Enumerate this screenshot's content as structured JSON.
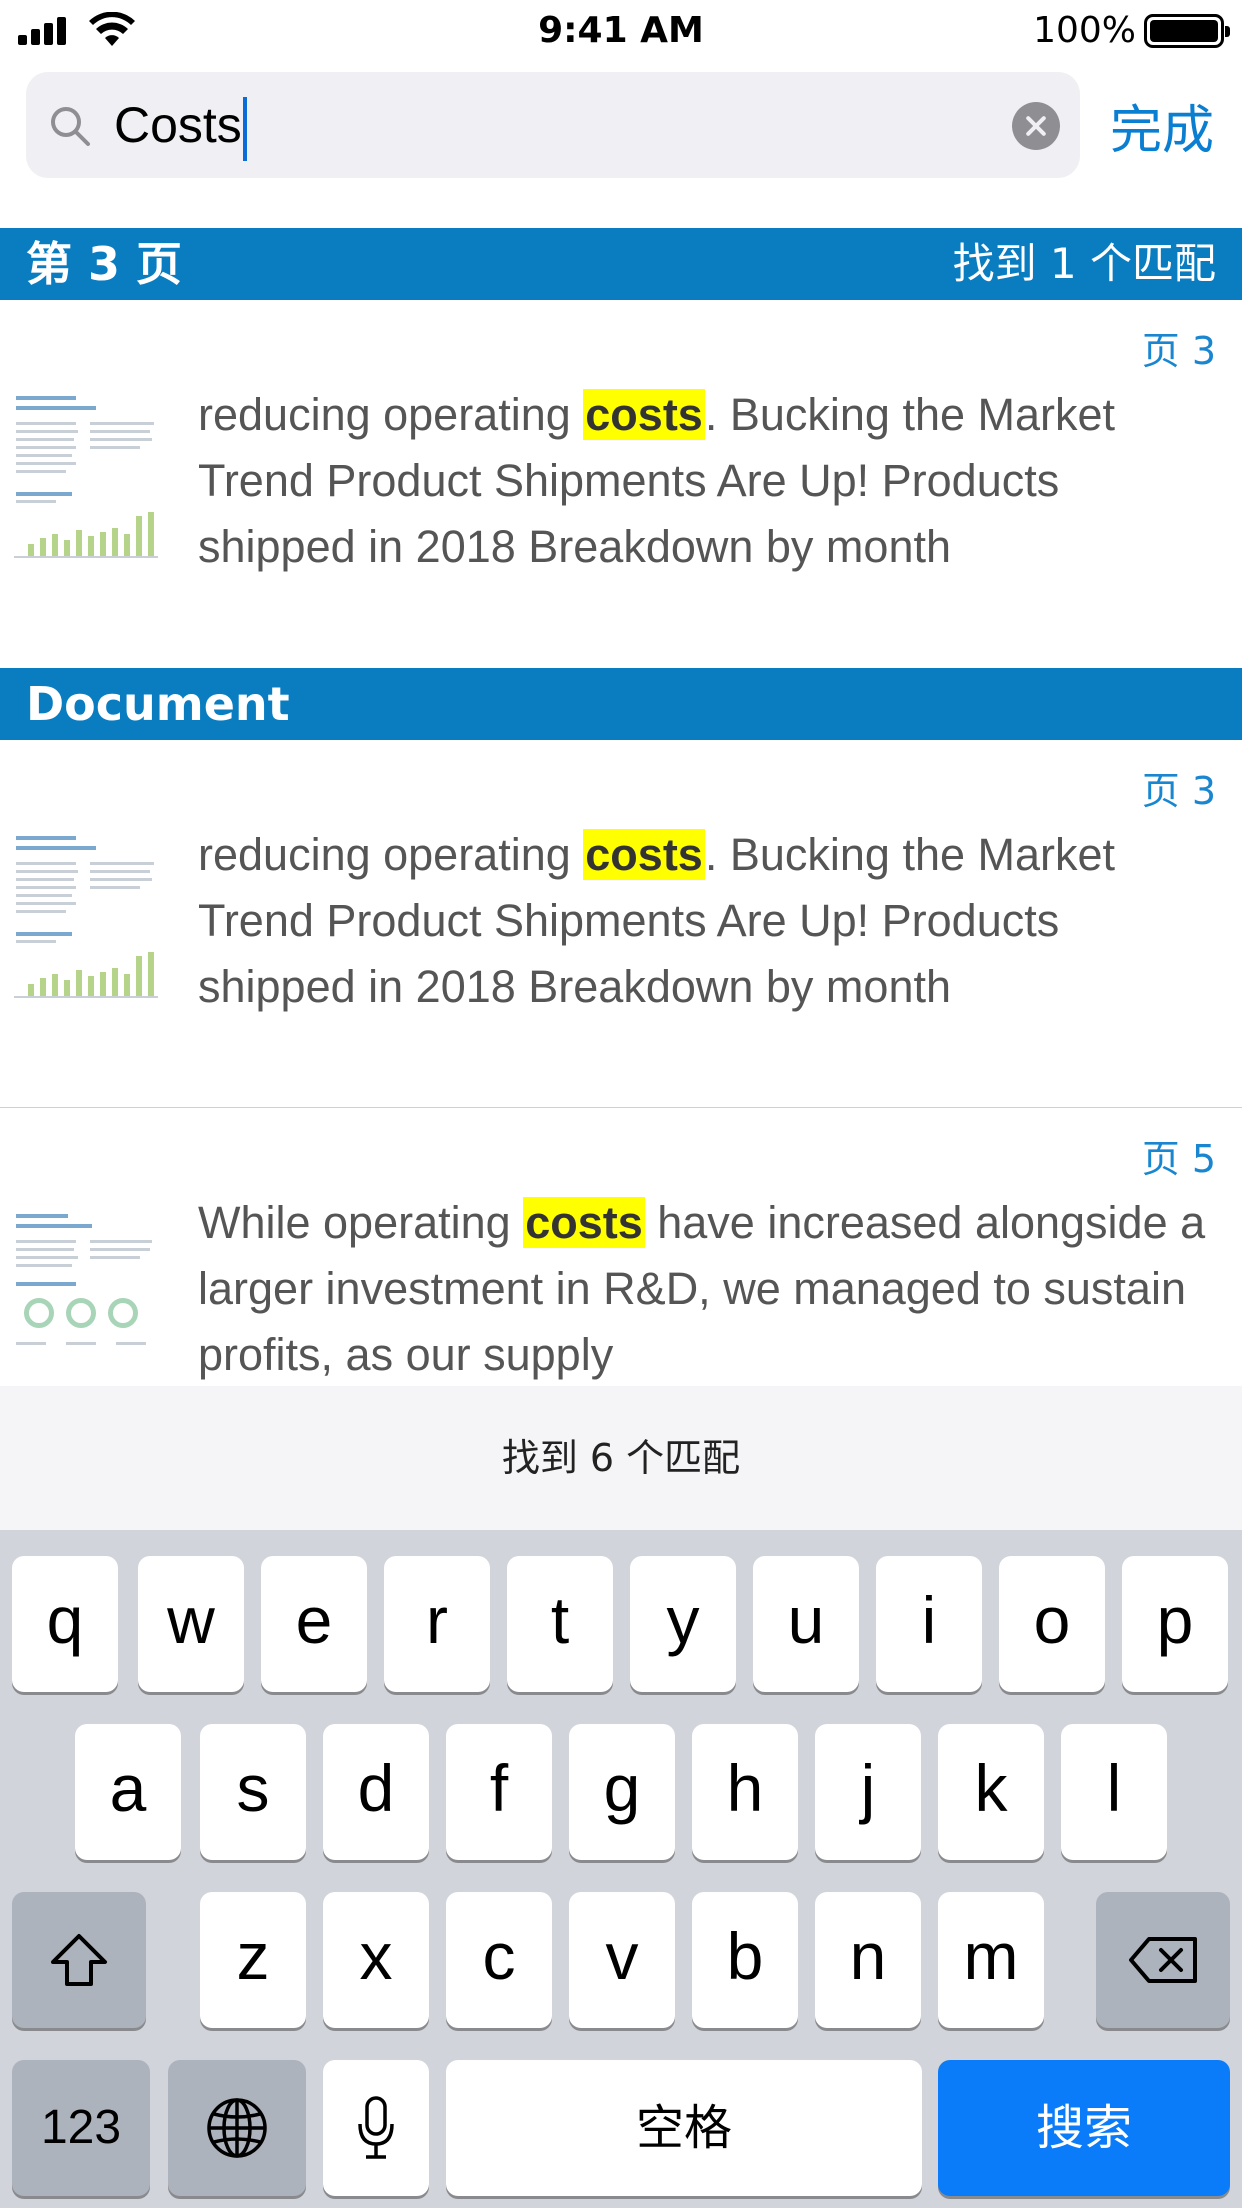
{
  "status_bar": {
    "time": "9:41 AM",
    "battery": "100%"
  },
  "search": {
    "query": "Costs",
    "done_label": "完成"
  },
  "sections": [
    {
      "title": "第 3 页",
      "match_count": "找到 1 个匹配",
      "results": [
        {
          "page": "页 3",
          "before": "reducing operating ",
          "match": "costs",
          "after": ". Bucking the Market Trend Product Shipments Are Up! Products shipped in 2018 Breakdown by month"
        }
      ]
    },
    {
      "title": "Document",
      "results": [
        {
          "page": "页 3",
          "before": "reducing operating ",
          "match": "costs",
          "after": ". Bucking the Market Trend Product Shipments Are Up! Products shipped in 2018 Breakdown by month"
        },
        {
          "page": "页 5",
          "before": "While operating ",
          "match": "costs",
          "after": " have increased alongside a larger investment in R&D, we managed to sustain profits, as our supply"
        }
      ]
    }
  ],
  "match_summary": "找到 6 个匹配",
  "keyboard": {
    "row1": [
      "q",
      "w",
      "e",
      "r",
      "t",
      "y",
      "u",
      "i",
      "o",
      "p"
    ],
    "row2": [
      "a",
      "s",
      "d",
      "f",
      "g",
      "h",
      "j",
      "k",
      "l"
    ],
    "row3": [
      "z",
      "x",
      "c",
      "v",
      "b",
      "n",
      "m"
    ],
    "numbers_label": "123",
    "space_label": "空格",
    "search_label": "搜索",
    "icons": [
      "shift-icon",
      "backspace-icon",
      "globe-icon",
      "microphone-icon"
    ]
  }
}
